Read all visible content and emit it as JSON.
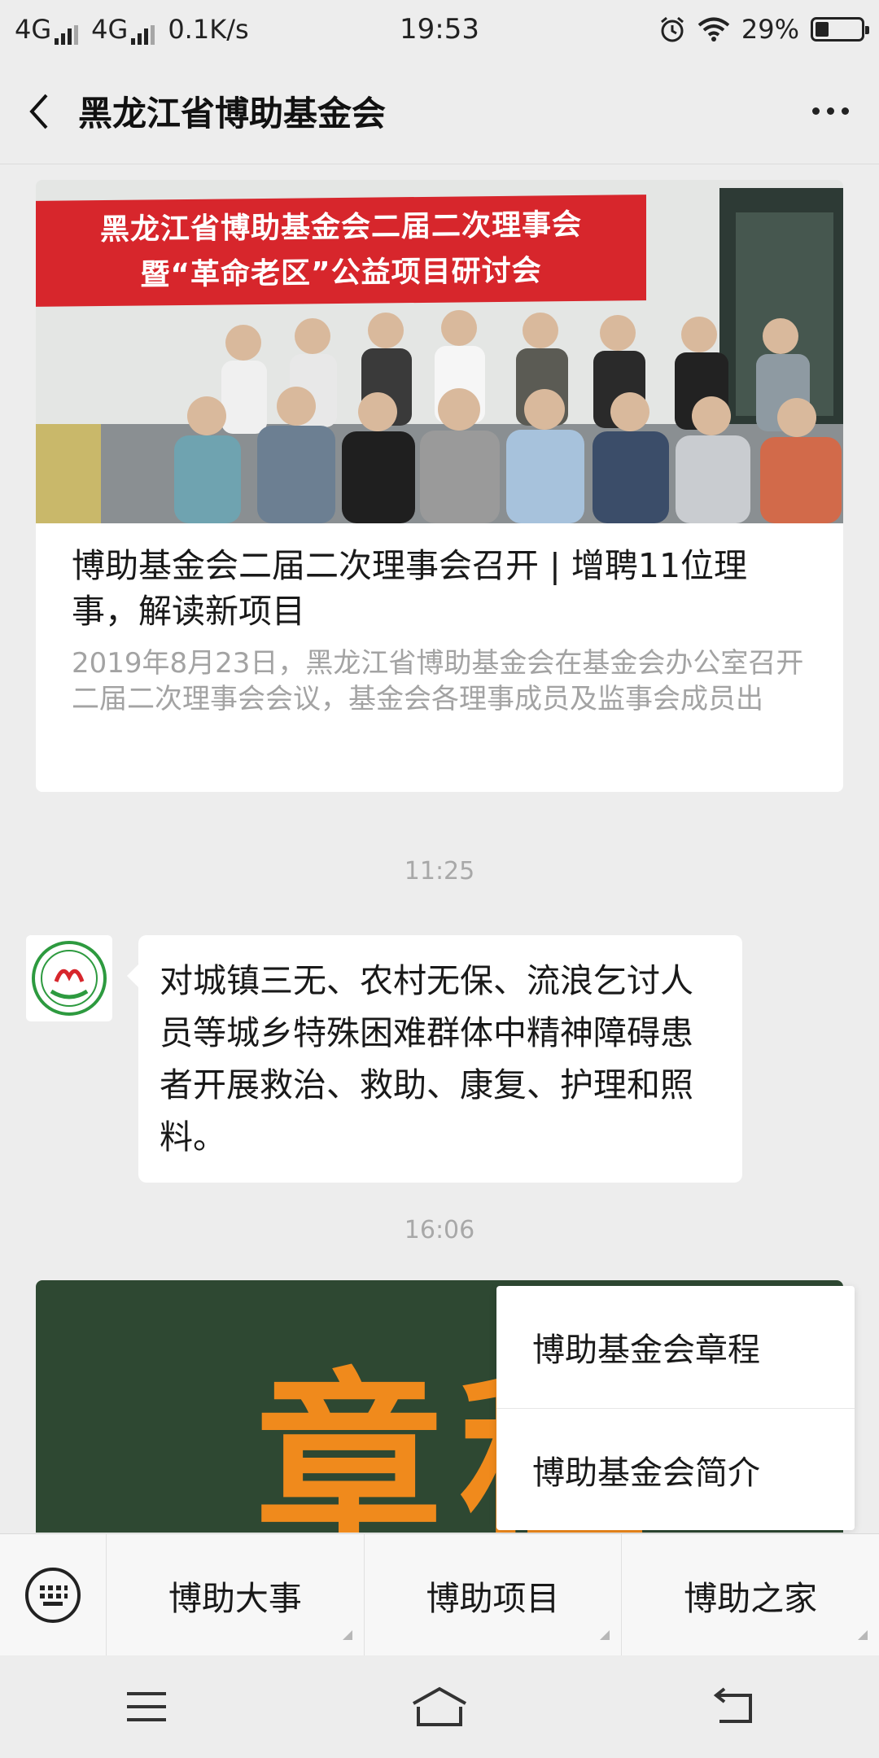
{
  "status_bar": {
    "network1": "4G",
    "network2": "4G",
    "speed": "0.1K/s",
    "time": "19:53",
    "battery": "29%",
    "battery_level": 0.29
  },
  "header": {
    "title": "黑龙江省博助基金会"
  },
  "article": {
    "banner_line1": "黑龙江省博助基金会二届二次理事会",
    "banner_line2": "暨“革命老区”公益项目研讨会",
    "title": "博助基金会二届二次理事会召开 | 增聘11位理事，解读新项目",
    "description": "2019年8月23日，黑龙江省博助基金会在基金会办公室召开二届二次理事会会议，基金会各理事成员及监事会成员出"
  },
  "messages": [
    {
      "time": "11:25",
      "text": "对城镇三无、农村无保、流浪乞讨人员等城乡特殊困难群体中精神障碍患者开展救治、救助、康复、护理和照料。"
    },
    {
      "time": "16:06",
      "card_glyph": "章程"
    }
  ],
  "popup_menu": {
    "items": [
      "博助基金会章程",
      "博助基金会简介"
    ]
  },
  "menu_bar": {
    "items": [
      "博助大事",
      "博助项目",
      "博助之家"
    ]
  },
  "colors": {
    "background": "#ededed",
    "banner_red": "#d7262c",
    "card_green": "#2e4832",
    "glyph_orange": "#f08a1c",
    "muted_text": "#a3a3a3"
  }
}
